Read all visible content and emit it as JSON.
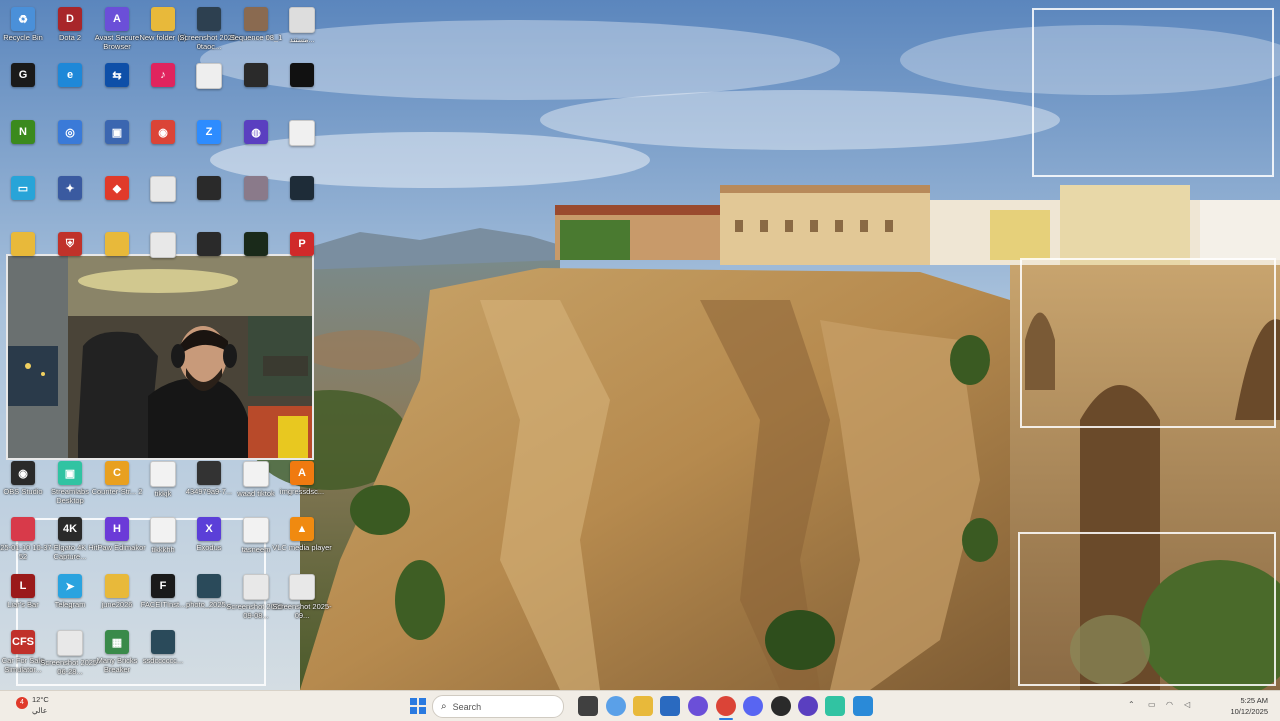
{
  "desktop": {
    "icons": [
      {
        "label": "Recycle Bin",
        "icon": "recycle-bin-icon",
        "color": "#4a90d9",
        "glyph": "♻"
      },
      {
        "label": "Dota 2",
        "icon": "dota-icon",
        "color": "#a8262a",
        "glyph": "D"
      },
      {
        "label": "Avast Secure Browser",
        "icon": "avast-browser-icon",
        "color": "#6b4fd8",
        "glyph": "A"
      },
      {
        "label": "New folder (2)",
        "icon": "folder-icon",
        "color": "#e8b93a",
        "glyph": ""
      },
      {
        "label": "Screenshot 2025-0taoc...",
        "icon": "screenshot-icon",
        "color": "#2d4050",
        "glyph": ""
      },
      {
        "label": "Sequence 08_1",
        "icon": "video-file-icon",
        "color": "#8a6a50",
        "glyph": ""
      },
      {
        "label": "مستند...",
        "icon": "document-icon",
        "color": "#dddddd",
        "glyph": ""
      },
      {
        "label": "",
        "icon": "g-hub-icon",
        "color": "#1a1a1a",
        "glyph": "G"
      },
      {
        "label": "",
        "icon": "edge-icon",
        "color": "#1e88d8",
        "glyph": "e"
      },
      {
        "label": "",
        "icon": "teamviewer-icon",
        "color": "#0e4fa8",
        "glyph": "⇆"
      },
      {
        "label": "",
        "icon": "tiktok-studio-icon",
        "color": "#e0245e",
        "glyph": "♪"
      },
      {
        "label": "",
        "icon": "file-icon",
        "color": "#eeeeee",
        "glyph": ""
      },
      {
        "label": "",
        "icon": "image-file-icon",
        "color": "#2a2a2a",
        "glyph": ""
      },
      {
        "label": "",
        "icon": "dark-file-icon",
        "color": "#111111",
        "glyph": ""
      },
      {
        "label": "",
        "icon": "nvidia-icon",
        "color": "#3b8a1e",
        "glyph": "N"
      },
      {
        "label": "",
        "icon": "browser-icon",
        "color": "#3a7ad8",
        "glyph": "◎"
      },
      {
        "label": "",
        "icon": "app-shortcut-icon",
        "color": "#3b66b0",
        "glyph": "▣"
      },
      {
        "label": "",
        "icon": "chrome-icon",
        "color": "#db4437",
        "glyph": "◉"
      },
      {
        "label": "",
        "icon": "zoom-icon",
        "color": "#2d8cff",
        "glyph": "Z"
      },
      {
        "label": "",
        "icon": "media-app-icon",
        "color": "#5a3fc0",
        "glyph": "◍"
      },
      {
        "label": "",
        "icon": "blank-doc-icon",
        "color": "#f0f0f0",
        "glyph": ""
      },
      {
        "label": "",
        "icon": "monitor-icon",
        "color": "#28a4d8",
        "glyph": "▭"
      },
      {
        "label": "",
        "icon": "game-icon",
        "color": "#3a5aa0",
        "glyph": "✦"
      },
      {
        "label": "",
        "icon": "anydesk-icon",
        "color": "#e03a2a",
        "glyph": "◆"
      },
      {
        "label": "",
        "icon": "screenshot-file-icon",
        "color": "#e8e8e8",
        "glyph": ""
      },
      {
        "label": "",
        "icon": "phone-file-icon",
        "color": "#2a2a2a",
        "glyph": ""
      },
      {
        "label": "",
        "icon": "image-thumbnail-icon",
        "color": "#8a7a8a",
        "glyph": ""
      },
      {
        "label": "",
        "icon": "dark-image-icon",
        "color": "#1e2c38",
        "glyph": ""
      },
      {
        "label": "",
        "icon": "folder-icon",
        "color": "#e8b93a",
        "glyph": ""
      },
      {
        "label": "",
        "icon": "shield-app-icon",
        "color": "#c0322a",
        "glyph": "⛨"
      },
      {
        "label": "",
        "icon": "folder-icon",
        "color": "#e8b93a",
        "glyph": ""
      },
      {
        "label": "",
        "icon": "screenshot-file-icon",
        "color": "#e8e8e8",
        "glyph": ""
      },
      {
        "label": "",
        "icon": "phone-file-icon",
        "color": "#2a2a2a",
        "glyph": ""
      },
      {
        "label": "",
        "icon": "game-file-icon",
        "color": "#1a2a1a",
        "glyph": ""
      },
      {
        "label": "",
        "icon": "pdf-app-icon",
        "color": "#d02a2a",
        "glyph": "P"
      },
      {
        "label": "OBS Studio",
        "icon": "obs-icon",
        "color": "#2a2a2a",
        "glyph": "◉"
      },
      {
        "label": "Streamlabs Desktop",
        "icon": "streamlabs-icon",
        "color": "#31c3a2",
        "glyph": "▣"
      },
      {
        "label": "Counter-Str... 2",
        "icon": "cs2-icon",
        "color": "#e8a020",
        "glyph": "C"
      },
      {
        "label": "tikkjk",
        "icon": "file-icon",
        "color": "#f2f2f2",
        "glyph": ""
      },
      {
        "label": "434979a9-7...",
        "icon": "phone-file-icon",
        "color": "#333333",
        "glyph": ""
      },
      {
        "label": "waad tiktok",
        "icon": "text-file-icon",
        "color": "#f2f2f2",
        "glyph": ""
      },
      {
        "label": "imgressdsc...",
        "icon": "avast-icon",
        "color": "#f07a10",
        "glyph": "A"
      },
      {
        "label": "2025-01-10 10-37-52",
        "icon": "video-file-icon",
        "color": "#d83a4a",
        "glyph": ""
      },
      {
        "label": "Elgato 4K Capture...",
        "icon": "elgato-icon",
        "color": "#2a2a2a",
        "glyph": "4K"
      },
      {
        "label": "HitPaw Edimakor",
        "icon": "hitpaw-icon",
        "color": "#6b3ad8",
        "glyph": "H"
      },
      {
        "label": "tikkkhh",
        "icon": "file-icon",
        "color": "#f2f2f2",
        "glyph": ""
      },
      {
        "label": "Exodus",
        "icon": "exodus-icon",
        "color": "#5b3fd8",
        "glyph": "X"
      },
      {
        "label": "tasneem",
        "icon": "text-file-icon",
        "color": "#f2f2f2",
        "glyph": ""
      },
      {
        "label": "VLC media player",
        "icon": "vlc-icon",
        "color": "#f08a10",
        "glyph": "▲"
      },
      {
        "label": "Liar's Bar",
        "icon": "liars-bar-icon",
        "color": "#9a1a1a",
        "glyph": "L"
      },
      {
        "label": "Telegram",
        "icon": "telegram-icon",
        "color": "#2aa3df",
        "glyph": "➤"
      },
      {
        "label": "june2026",
        "icon": "folder-icon",
        "color": "#e8b93a",
        "glyph": ""
      },
      {
        "label": "FACEITInst...",
        "icon": "faceit-icon",
        "color": "#1a1a1a",
        "glyph": "F"
      },
      {
        "label": "photo_2025...",
        "icon": "image-file-icon",
        "color": "#2a4a5a",
        "glyph": ""
      },
      {
        "label": "Screenshot 2025-09-08...",
        "icon": "screenshot-file-icon",
        "color": "#e8e8e8",
        "glyph": ""
      },
      {
        "label": "Screenshot 2025-09...",
        "icon": "screenshot-file-icon",
        "color": "#e8e8e8",
        "glyph": ""
      },
      {
        "label": "Car For Sale Simulator...",
        "icon": "car-game-icon",
        "color": "#c0302a",
        "glyph": "CFS"
      },
      {
        "label": "Screenshot 2025-06-28...",
        "icon": "screenshot-file-icon",
        "color": "#e8e8e8",
        "glyph": ""
      },
      {
        "label": "Many Bricks Breaker",
        "icon": "bricks-game-icon",
        "color": "#3a8a4a",
        "glyph": "▦"
      },
      {
        "label": "ssdcccccc...",
        "icon": "image-file-icon",
        "color": "#2a4a5a",
        "glyph": ""
      }
    ]
  },
  "taskbar": {
    "weather": {
      "temp": "12°C",
      "caption": "عالي",
      "badge": "4"
    },
    "search_placeholder": "Search",
    "clock": {
      "time": "5:25 AM",
      "date": "10/12/2025"
    },
    "apps": [
      {
        "icon": "windows-start-icon",
        "color": "#2a7ae0"
      },
      {
        "icon": "task-view-icon",
        "color": "#404040"
      },
      {
        "icon": "copilot-icon",
        "color": "#5aa0e8"
      },
      {
        "icon": "file-explorer-icon",
        "color": "#e8b93a"
      },
      {
        "icon": "store-icon",
        "color": "#2a6ac0"
      },
      {
        "icon": "avast-browser-icon",
        "color": "#6b4fd8"
      },
      {
        "icon": "chrome-icon",
        "color": "#db4437"
      },
      {
        "icon": "discord-icon",
        "color": "#5865f2"
      },
      {
        "icon": "obs-icon",
        "color": "#2a2a2a"
      },
      {
        "icon": "media-app-icon",
        "color": "#5a3fc0"
      },
      {
        "icon": "streamlabs-icon",
        "color": "#31c3a2"
      },
      {
        "icon": "active-window-icon",
        "color": "#2a8ad8"
      }
    ]
  }
}
